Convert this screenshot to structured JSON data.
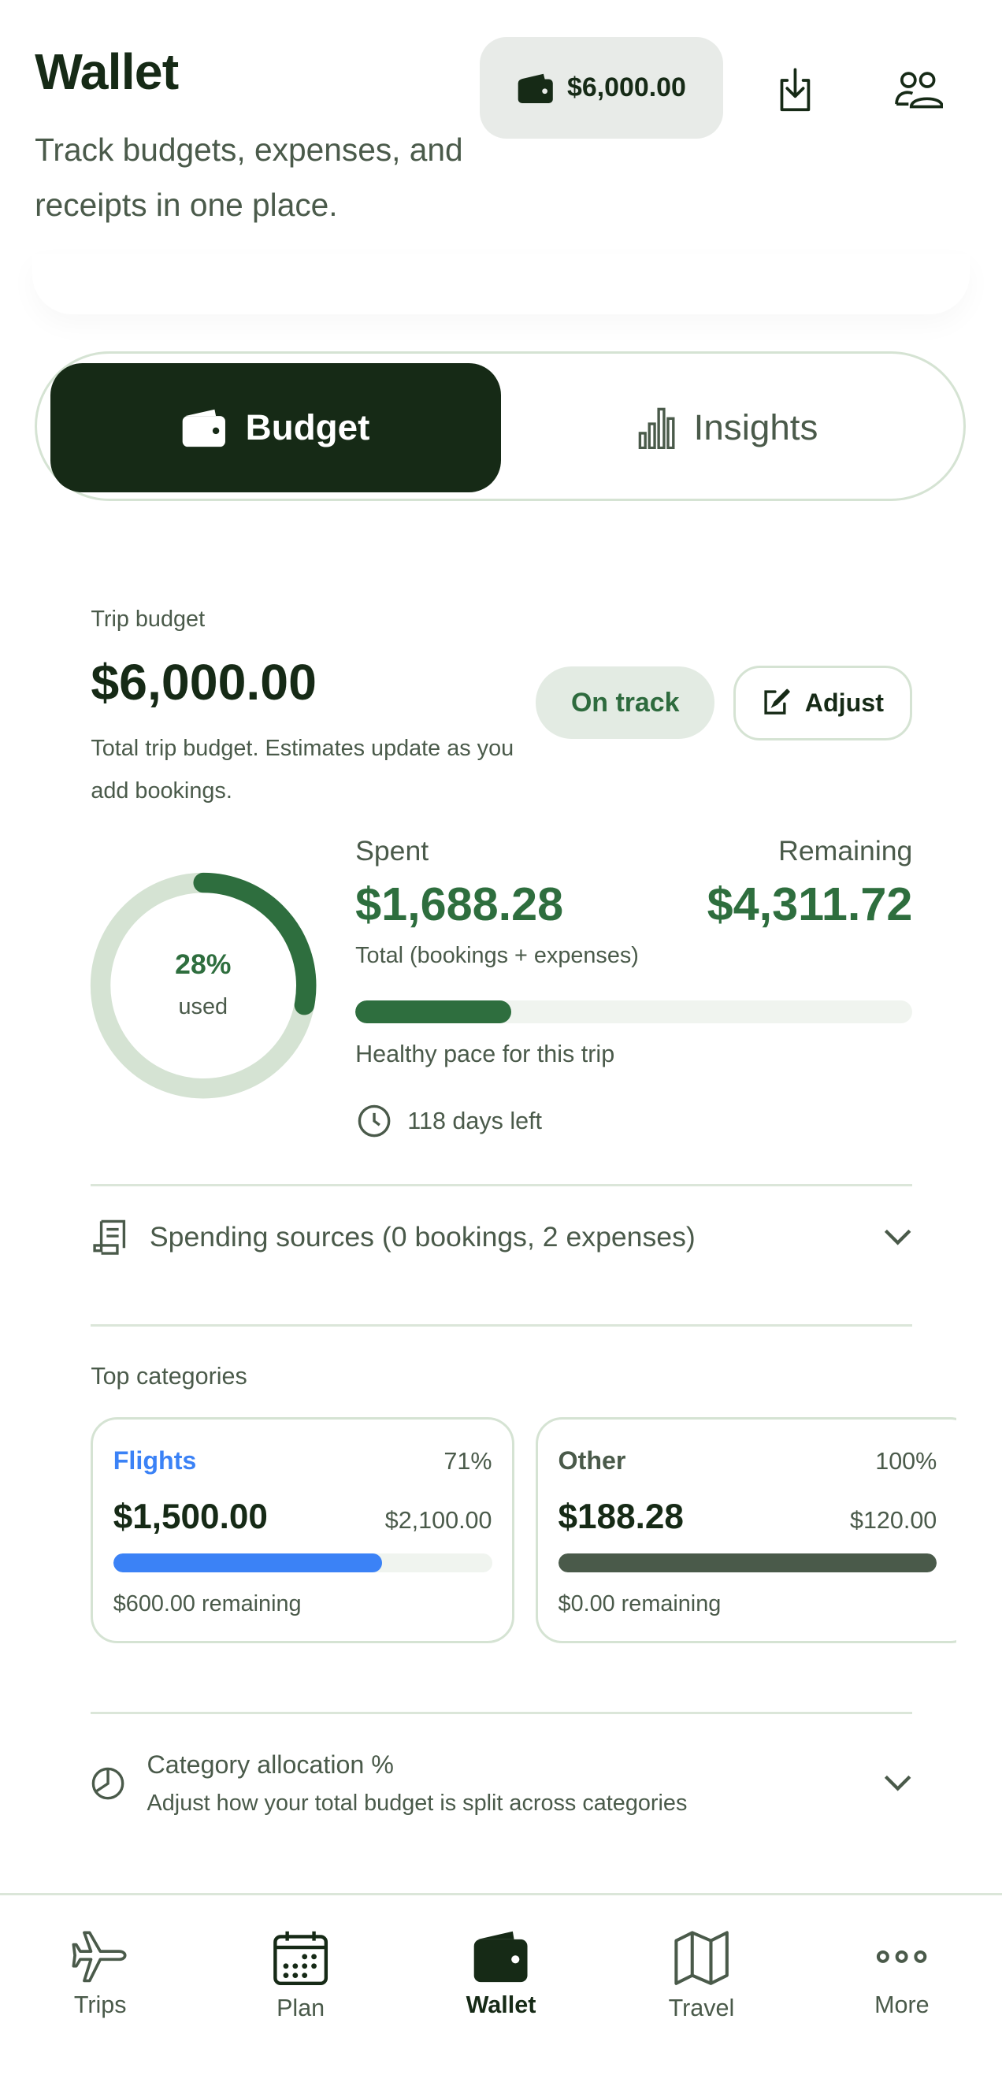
{
  "header": {
    "title": "Wallet",
    "subtitle": "Track budgets, expenses, and receipts in one place.",
    "balance": "$6,000.00"
  },
  "tabs": [
    {
      "label": "Budget",
      "icon": "wallet-icon",
      "active": true
    },
    {
      "label": "Insights",
      "icon": "bar-chart-icon",
      "active": false
    }
  ],
  "budget": {
    "label": "Trip budget",
    "amount": "$6,000.00",
    "description": "Total trip budget. Estimates update as you add bookings.",
    "status": "On track",
    "adjust_label": "Adjust",
    "used_percent_label": "28%",
    "used_label": "used",
    "used_fraction": 0.28,
    "spent_label": "Spent",
    "spent": "$1,688.28",
    "remaining_label": "Remaining",
    "remaining": "$4,311.72",
    "spent_note": "Total (bookings + expenses)",
    "pace": "Healthy pace for this trip",
    "days_left": "118 days left"
  },
  "spending_sources": "Spending sources (0 bookings, 2 expenses)",
  "top_categories": {
    "label": "Top categories",
    "items": [
      {
        "name": "Flights",
        "percent": "71%",
        "spent": "$1,500.00",
        "budget": "$2,100.00",
        "remaining": "$600.00 remaining",
        "fill": 0.71,
        "color": "#3b82f6"
      },
      {
        "name": "Other",
        "percent": "100%",
        "spent": "$188.28",
        "budget": "$120.00",
        "remaining": "$0.00 remaining",
        "fill": 1.0,
        "color": "#4a5a4a"
      }
    ]
  },
  "allocation": {
    "title": "Category allocation %",
    "subtitle": "Adjust how your total budget is split across categories"
  },
  "nav": [
    {
      "label": "Trips",
      "icon": "plane-icon"
    },
    {
      "label": "Plan",
      "icon": "calendar-icon"
    },
    {
      "label": "Wallet",
      "icon": "wallet-icon",
      "active": true
    },
    {
      "label": "Travel",
      "icon": "map-icon"
    },
    {
      "label": "More",
      "icon": "more-icon"
    }
  ],
  "colors": {
    "primary": "#162a16",
    "accent": "#2e6e3e",
    "border": "#d5e3d3"
  }
}
